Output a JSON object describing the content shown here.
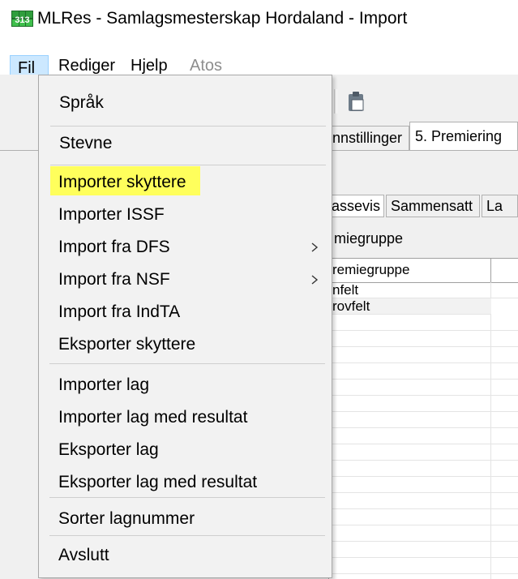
{
  "window": {
    "title": "MLRes - Samlagsmesterskap Hordaland - Import",
    "icon": "app-grid-icon"
  },
  "menubar": {
    "items": [
      {
        "label": "Fil",
        "state": "open"
      },
      {
        "label": "Rediger",
        "state": "normal"
      },
      {
        "label": "Hjelp",
        "state": "normal"
      },
      {
        "label": "Atos",
        "state": "disabled"
      }
    ]
  },
  "file_menu": {
    "items": [
      {
        "label": "Språk"
      },
      {
        "label": "Stevne"
      },
      {
        "label": "Importer skyttere",
        "highlighted": true
      },
      {
        "label": "Importer ISSF"
      },
      {
        "label": "Import fra DFS",
        "submenu": true
      },
      {
        "label": "Import fra NSF",
        "submenu": true
      },
      {
        "label": "Import fra IndTA"
      },
      {
        "label": "Eksporter skyttere"
      },
      {
        "label": "Importer lag"
      },
      {
        "label": "Importer lag med resultat"
      },
      {
        "label": "Eksporter lag"
      },
      {
        "label": "Eksporter lag med resultat"
      },
      {
        "label": "Sorter lagnummer"
      },
      {
        "label": "Avslutt"
      }
    ],
    "highlight_color": "#ffff5c"
  },
  "background": {
    "tabs": [
      {
        "label": "nnstillinger"
      },
      {
        "label": "5. Premiering",
        "active": true
      }
    ],
    "subtabs": [
      {
        "label": "assevis"
      },
      {
        "label": "Sammensatt"
      },
      {
        "label": "La"
      }
    ],
    "group_label": "miegruppe",
    "grid": {
      "header": "remiegruppe",
      "rows": [
        "nfelt",
        "rovfelt"
      ]
    }
  }
}
